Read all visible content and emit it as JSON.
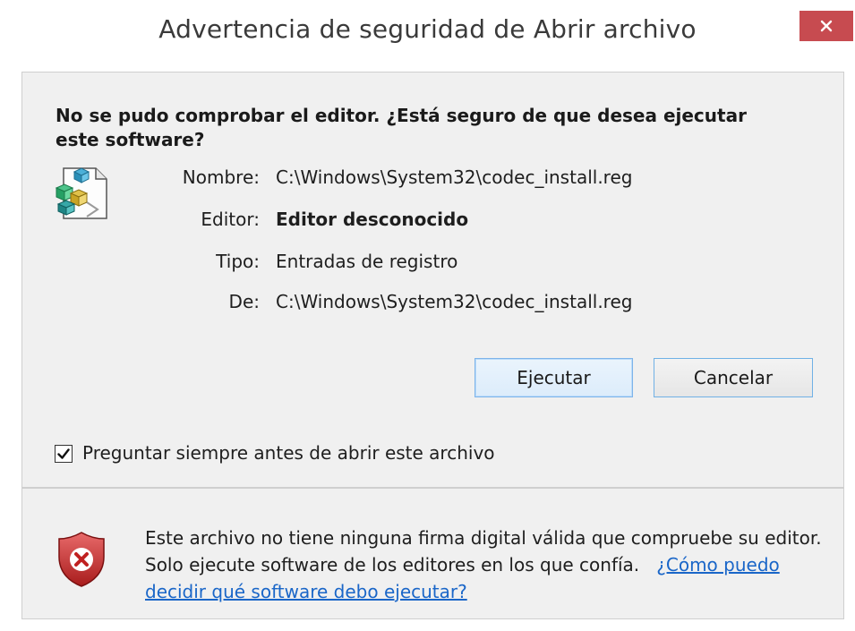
{
  "window": {
    "title": "Advertencia de seguridad de Abrir archivo",
    "close_icon": "close-icon"
  },
  "prompt": {
    "heading": "No se pudo comprobar el editor. ¿Está seguro de que desea ejecutar este software?"
  },
  "file": {
    "icon": "registry-file-icon",
    "rows": [
      {
        "label": "Nombre:",
        "value": "C:\\Windows\\System32\\codec_install.reg"
      },
      {
        "label": "Editor:",
        "value": "Editor desconocido"
      },
      {
        "label": "Tipo:",
        "value": "Entradas de registro"
      },
      {
        "label": "De:",
        "value": "C:\\Windows\\System32\\codec_install.reg"
      }
    ]
  },
  "buttons": {
    "run": "Ejecutar",
    "cancel": "Cancelar"
  },
  "checkbox": {
    "label": "Preguntar siempre antes de abrir este archivo",
    "checked": true
  },
  "footer": {
    "icon": "warning-shield-icon",
    "text": "Este archivo no tiene ninguna firma digital válida que compruebe su editor. Solo ejecute software de los editores en los que confía.",
    "link": "¿Cómo puedo decidir qué software debo ejecutar?"
  },
  "colors": {
    "close_button": "#c74b50",
    "accent_border": "#7eb4ea",
    "link": "#1a66c8"
  }
}
